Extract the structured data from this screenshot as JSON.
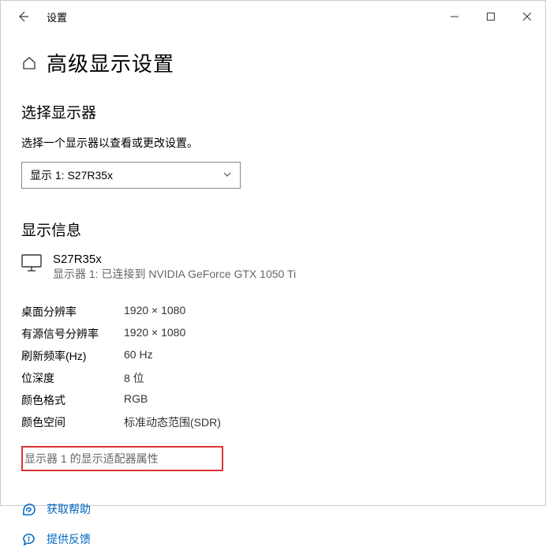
{
  "titlebar": {
    "app_name": "设置"
  },
  "header": {
    "page_title": "高级显示设置"
  },
  "select_display": {
    "title": "选择显示器",
    "desc": "选择一个显示器以查看或更改设置。",
    "selected": "显示 1: S27R35x"
  },
  "display_info": {
    "title": "显示信息",
    "monitor_name": "S27R35x",
    "connection": "显示器 1: 已连接到 NVIDIA GeForce GTX 1050 Ti",
    "rows": [
      {
        "label": "桌面分辨率",
        "value": "1920 × 1080"
      },
      {
        "label": "有源信号分辨率",
        "value": "1920 × 1080"
      },
      {
        "label": "刷新频率(Hz)",
        "value": "60 Hz"
      },
      {
        "label": "位深度",
        "value": "8 位"
      },
      {
        "label": "颜色格式",
        "value": "RGB"
      },
      {
        "label": "颜色空间",
        "value": "标准动态范围(SDR)"
      }
    ],
    "adapter_link": "显示器 1 的显示适配器属性"
  },
  "help": {
    "get_help": "获取帮助",
    "feedback": "提供反馈"
  }
}
